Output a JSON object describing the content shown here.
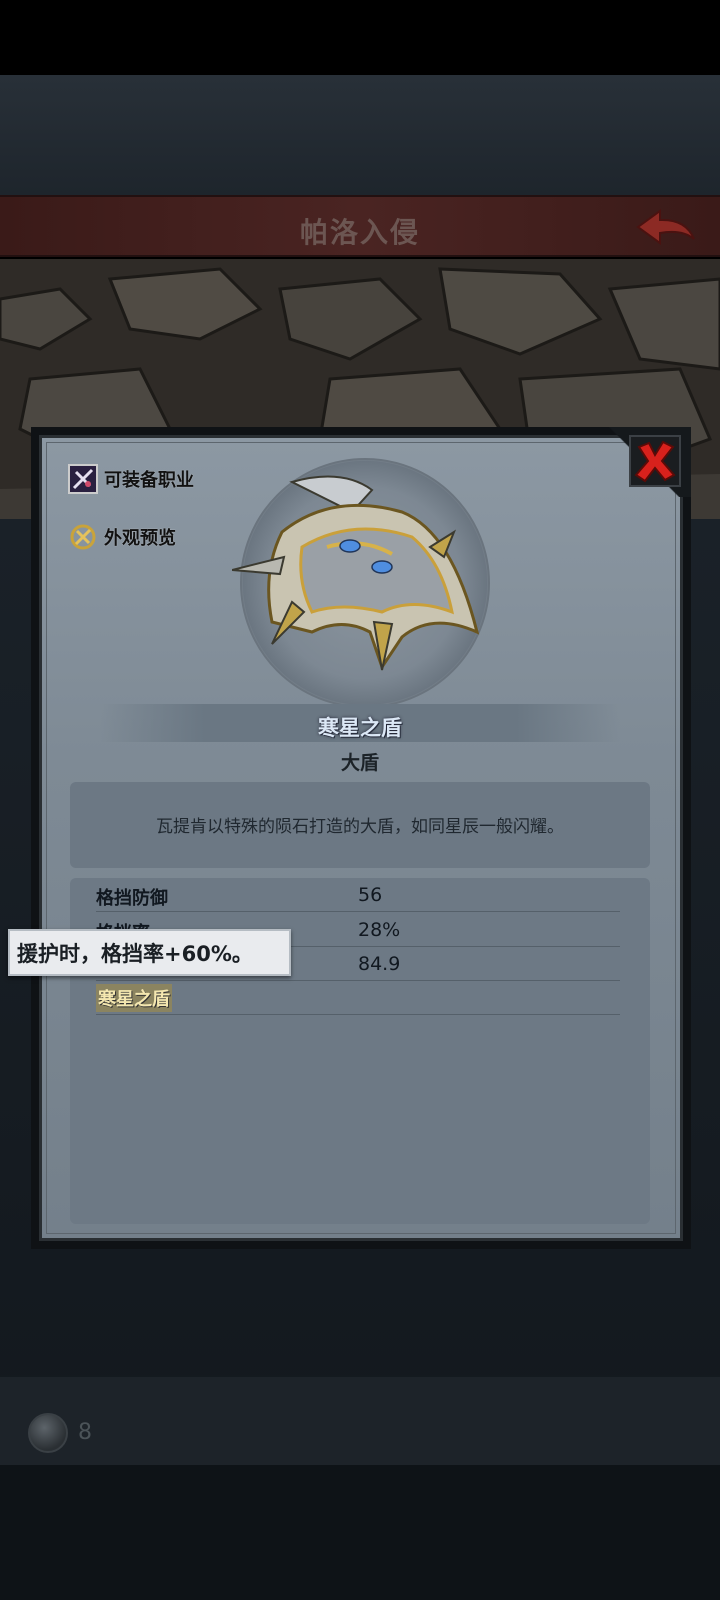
{
  "header": {
    "title": "帕洛入侵"
  },
  "bottom_bar": {
    "currency_count": "8"
  },
  "dialog": {
    "side_buttons": [
      {
        "label": "可装备职业",
        "icon": "class-icon"
      },
      {
        "label": "外观预览",
        "icon": "appearance-icon"
      }
    ],
    "item": {
      "name": "寒星之盾",
      "type": "大盾",
      "description": "瓦提肯以特殊的陨石打造的大盾，如同星辰一般闪耀。"
    },
    "stats": [
      {
        "name": "格挡防御",
        "value": "56"
      },
      {
        "name": "格挡率",
        "value": "28%"
      },
      {
        "name": "",
        "value": "84.9"
      }
    ],
    "set_name": "寒星之盾",
    "tooltip": "援护时，格挡率+60%。"
  },
  "colors": {
    "close_red": "#d8211c",
    "item_name": "#dce8f6",
    "set_highlight": "#8b8460"
  }
}
